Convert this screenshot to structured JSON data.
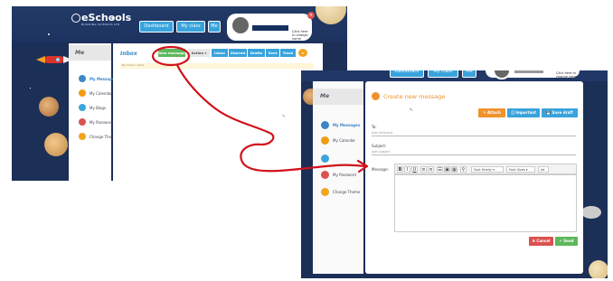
{
  "left": {
    "logo": {
      "name": "eSchools",
      "tagline": "BUILDING SCHOOLS LTD"
    },
    "topnav": [
      "Dashboard",
      "My class",
      "Me"
    ],
    "user_hint": "Click here to change name",
    "sidebar": {
      "title": "Me",
      "items": [
        {
          "label": "My Messages",
          "color": "#3f86c6"
        },
        {
          "label": "My Calendar",
          "color": "#f39c12"
        },
        {
          "label": "My Blogs",
          "color": "#3aa7d9"
        },
        {
          "label": "My Password",
          "color": "#d9534f"
        },
        {
          "label": "Change Theme",
          "color": "#f0a51e"
        }
      ]
    },
    "inbox": {
      "title": "Inbox",
      "new_message": "New message",
      "action": "Action",
      "folders": [
        "Inbox",
        "Starred",
        "Drafts",
        "Sent",
        "Trash"
      ],
      "empty_text": "No mail in inbox"
    }
  },
  "right": {
    "topnav": [
      "Dashboard",
      "My class",
      "Me"
    ],
    "user_hint": "Click here to change name",
    "sidebar": {
      "title": "Me",
      "items": [
        {
          "label": "My Messages",
          "color": "#3f86c6"
        },
        {
          "label": "My Calendar",
          "color": "#f39c12"
        },
        {
          "label": "",
          "color": "#3aa7d9"
        },
        {
          "label": "My Password",
          "color": "#d9534f"
        },
        {
          "label": "Change Theme",
          "color": "#f0a51e"
        }
      ]
    },
    "compose": {
      "title": "Create new message",
      "attach": "Attach",
      "important": "Important",
      "save_draft": "Save draft",
      "to_label": "To:",
      "to_placeholder": "Add recipient",
      "subject_label": "Subject:",
      "subject_placeholder": "Add subject",
      "message_label": "Message:",
      "font_family": "Font Family",
      "font_size": "Font Sizes",
      "cancel": "Cancel",
      "send": "Send"
    }
  },
  "colors": {
    "accent_green": "#5cb85c",
    "accent_orange": "#f0932b",
    "annotation_red": "#d0121b"
  }
}
